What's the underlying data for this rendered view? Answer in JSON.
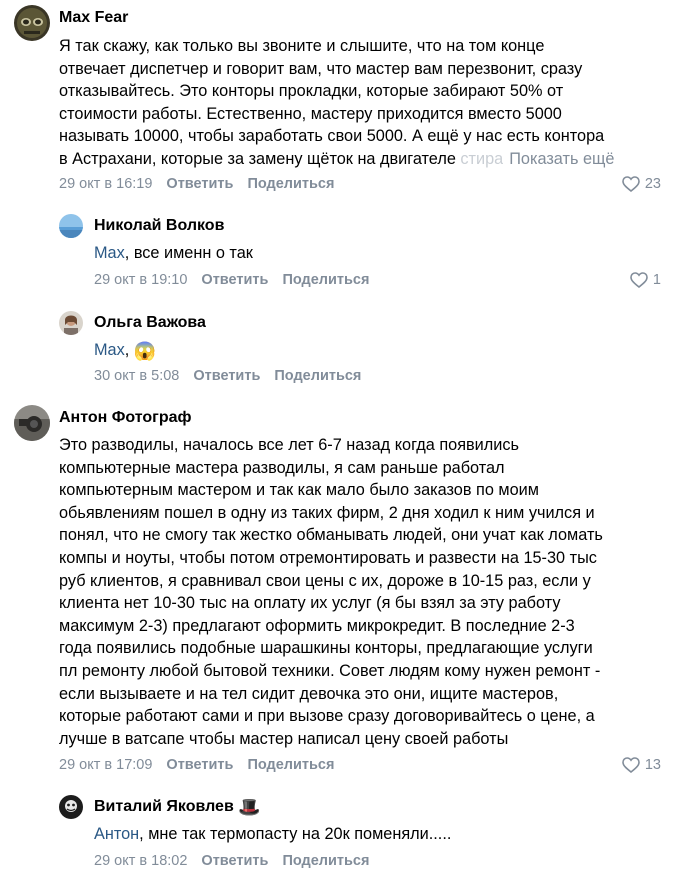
{
  "comments": [
    {
      "author": "Max Fear",
      "text": "Я так скажу, как только вы звоните и слышите, что на том конце\nотвечает диспетчер и говорит вам, что мастер вам перезвонит, сразу\nотказывайтесь. Это конторы прокладки, которые забирают 50% от\nстоимости работы. Естественно, мастеру приходится вместо 5000\nназывать 10000, чтобы заработать свои 5000. А ещё у нас есть контора\nв Астрахани, которые за замену щёток на двигателе",
      "text_faded": " стира",
      "show_more": "Показать ещё",
      "date": "29 окт в 16:19",
      "reply": "Ответить",
      "share": "Поделиться",
      "likes": "23"
    },
    {
      "author": "Николай Волков",
      "mention": "Max",
      "text": ", все именн о так",
      "date": "29 окт в 19:10",
      "reply": "Ответить",
      "share": "Поделиться",
      "likes": "1"
    },
    {
      "author": "Ольга Важова",
      "mention": "Max",
      "text": ", ",
      "emoji": "😱",
      "date": "30 окт в 5:08",
      "reply": "Ответить",
      "share": "Поделиться"
    },
    {
      "author": "Антон Фотограф",
      "text": "Это разводилы, началось все лет 6-7 назад когда появились\nкомпьютерные мастера разводилы, я сам раньше работал\nкомпьютерным мастером и так как мало было заказов по моим\nобьявлениям пошел в одну из таких фирм, 2 дня ходил к ним учился и\nпонял, что не смогу так жестко обманывать людей, они учат как ломать\nкомпы и ноуты, чтобы потом отремонтировать и развести на 15-30 тыс\nруб клиентов, я сравнивал свои цены с их, дороже в 10-15 раз, если у\nклиента нет 10-30 тыс на оплату их услуг (я бы взял за эту работу\nмаксимум 2-3) предлагают оформить микрокредит. В последние 2-3\nгода появились подобные шарашкины конторы, предлагающие услуги\nпл ремонту любой бытовой техники. Совет людям кому нужен ремонт -\nесли вызываете и на тел сидит девочка это они, ищите мастеров,\nкоторые работают сами и при вызове сразу договоривайтесь о цене, а\nлучше в ватсапе чтобы мастер написал цену своей работы",
      "date": "29 окт в 17:09",
      "reply": "Ответить",
      "share": "Поделиться",
      "likes": "13"
    },
    {
      "author": "Виталий Яковлев",
      "author_badge": "🎩",
      "mention": "Антон",
      "text": ", мне так термопасту на 20к поменяли.....",
      "date": "29 окт в 18:02",
      "reply": "Ответить",
      "share": "Поделиться"
    }
  ],
  "colors": {
    "mention": "#2a5885",
    "meta": "#818c99"
  },
  "icons": {
    "like": "heart-outline-icon"
  }
}
